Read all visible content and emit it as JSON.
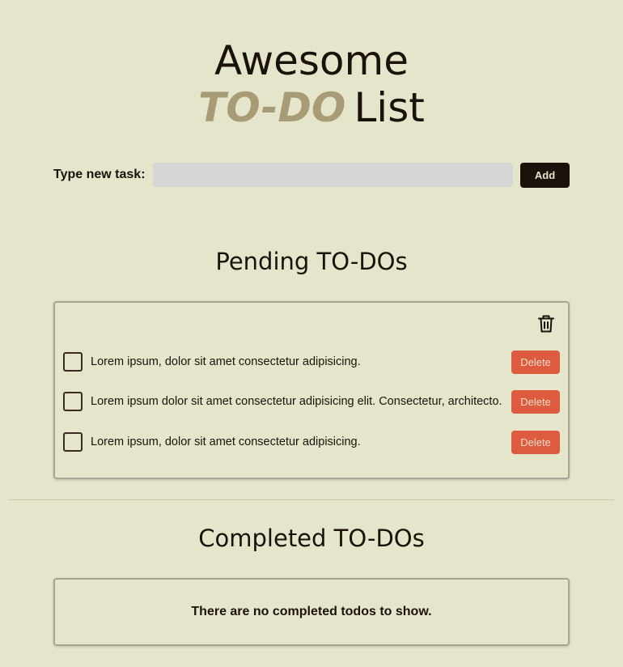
{
  "header": {
    "title_line1": "Awesome",
    "title_accent": "TO-DO",
    "title_rest": "List"
  },
  "new_task": {
    "label": "Type new task:",
    "value": "",
    "placeholder": "",
    "add_label": "Add"
  },
  "pending": {
    "heading": "Pending TO-DOs",
    "clear_icon": "trash-icon",
    "items": [
      {
        "text": "Lorem ipsum, dolor sit amet consectetur adipisicing.",
        "checked": false,
        "delete_label": "Delete"
      },
      {
        "text": "Lorem ipsum dolor sit amet consectetur adipisicing elit. Consectetur, architecto.",
        "checked": false,
        "delete_label": "Delete"
      },
      {
        "text": "Lorem ipsum, dolor sit amet consectetur adipisicing.",
        "checked": false,
        "delete_label": "Delete"
      }
    ]
  },
  "completed": {
    "heading": "Completed TO-DOs",
    "empty_message": "There are no completed todos to show."
  },
  "colors": {
    "background": "#e5e5cb",
    "text": "#1a120b",
    "accent": "#a79c76",
    "delete": "#dd5b3e",
    "input_bg": "#d6d6d6"
  }
}
